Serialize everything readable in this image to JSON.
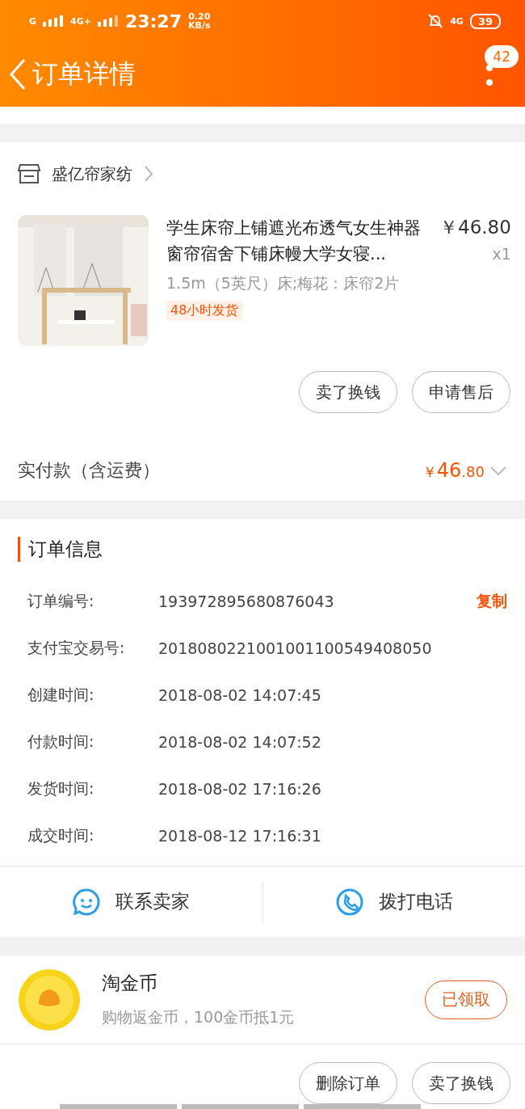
{
  "status_bar": {
    "network_left": "G",
    "network_right": "4G+",
    "time": "23:27",
    "speed_value": "0.20",
    "speed_unit": "KB/s",
    "network_4g": "4G",
    "battery": "39"
  },
  "header": {
    "title": "订单详情",
    "badge": "42"
  },
  "shop": {
    "name": "盛亿帘家纺"
  },
  "product": {
    "title": "学生床帘上铺遮光布透气女生神器窗帘宿舍下铺床幔大学女寝...",
    "price": "￥46.80",
    "quantity": "x1",
    "spec": "1.5m（5英尺）床;梅花：床帘2片",
    "tag": "48小时发货"
  },
  "item_buttons": [
    "卖了换钱",
    "申请售后"
  ],
  "total": {
    "label": "实付款（含运费）",
    "currency": "￥",
    "integer": "46",
    "decimal": ".80",
    "expanded": false
  },
  "order_info": {
    "title": "订单信息",
    "rows": [
      {
        "label": "订单编号:",
        "value": "193972895680876043",
        "action": "复制"
      },
      {
        "label": "支付宝交易号:",
        "value": "2018080221001001100549408050"
      },
      {
        "label": "创建时间:",
        "value": "2018-08-02 14:07:45"
      },
      {
        "label": "付款时间:",
        "value": "2018-08-02 14:07:52"
      },
      {
        "label": "发货时间:",
        "value": "2018-08-02 17:16:26"
      },
      {
        "label": "成交时间:",
        "value": "2018-08-12 17:16:31"
      }
    ]
  },
  "contact": [
    {
      "kind": "chat",
      "label": "联系卖家"
    },
    {
      "kind": "phone",
      "label": "拨打电话"
    }
  ],
  "coins": {
    "title": "淘金币",
    "subtitle": "购物返金币，100金币抵1元",
    "button": "已领取"
  },
  "bottom_buttons": [
    "删除订单",
    "卖了换钱"
  ]
}
